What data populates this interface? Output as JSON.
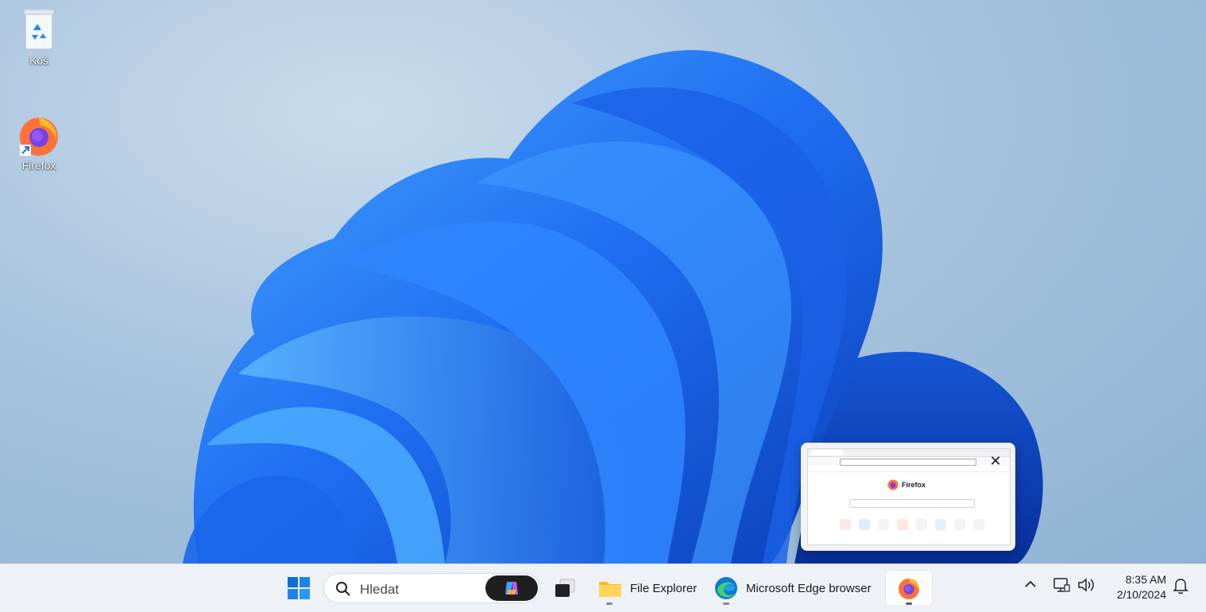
{
  "desktop": {
    "icons": [
      {
        "label": "Koš",
        "icon": "recycle-bin-icon"
      },
      {
        "label": "Firefox",
        "icon": "firefox-icon",
        "shortcut": true
      }
    ]
  },
  "preview": {
    "app": "Firefox",
    "logo_text": "Firefox",
    "close_icon": "close-icon"
  },
  "taskbar": {
    "start_icon": "windows-start-icon",
    "search": {
      "placeholder": "Hledat",
      "icon": "search-icon",
      "copilot_icon": "copilot-icon"
    },
    "task_view_icon": "task-view-icon",
    "apps": [
      {
        "label": "File Explorer",
        "icon": "folder-icon"
      },
      {
        "label": "Microsoft Edge browser",
        "icon": "edge-icon"
      },
      {
        "label": "",
        "icon": "firefox-icon",
        "active": true
      }
    ],
    "tray": {
      "chevron_icon": "chevron-up-icon",
      "network_icon": "network-icon",
      "volume_icon": "volume-icon",
      "notification_icon": "bell-icon"
    },
    "clock": {
      "time": "8:35 AM",
      "date": "2/10/2024"
    }
  },
  "colors": {
    "wallpaper_bg": "#a7c3dd",
    "bloom_blue": "#1a6bf0",
    "taskbar_bg": "#eef1f6"
  }
}
